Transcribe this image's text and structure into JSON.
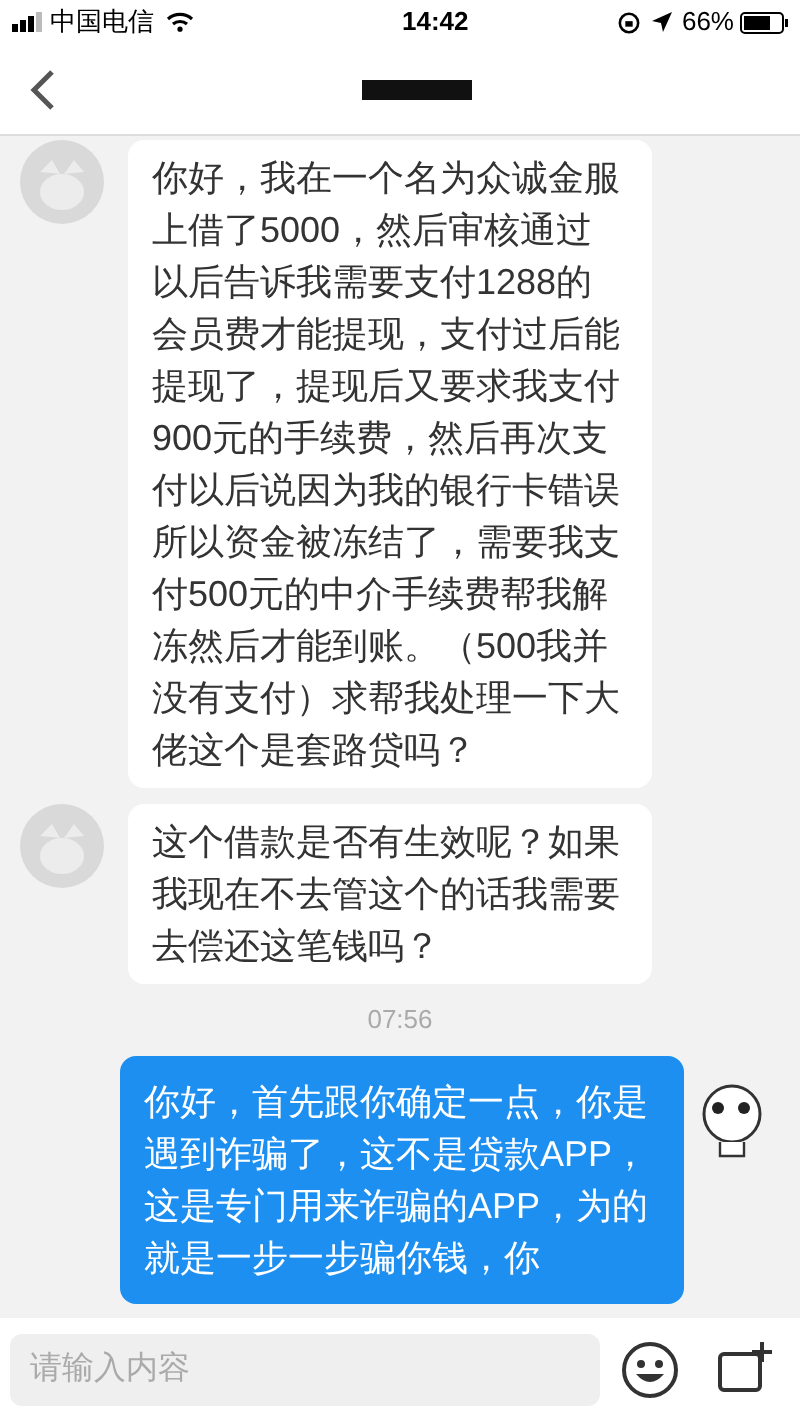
{
  "status_bar": {
    "carrier": "中国电信",
    "time": "14:42",
    "battery": "66%"
  },
  "messages": [
    {
      "kind": "incoming",
      "text": "你好，我在一个名为众诚金服上借了5000，然后审核通过以后告诉我需要支付1288的会员费才能提现，支付过后能提现了，提现后又要求我支付900元的手续费，然后再次支付以后说因为我的银行卡错误所以资金被冻结了，需要我支付500元的中介手续费帮我解冻然后才能到账。（500我并没有支付）求帮我处理一下大佬这个是套路贷吗？"
    },
    {
      "kind": "incoming",
      "text": "这个借款是否有生效呢？如果我现在不去管这个的话我需要去偿还这笔钱吗？"
    },
    {
      "kind": "time",
      "text": "07:56"
    },
    {
      "kind": "outgoing",
      "text": "你好，首先跟你确定一点，你是遇到诈骗了，这不是贷款APP，这是专门用来诈骗的APP，为的就是一步一步骗你钱，你"
    }
  ],
  "composer": {
    "placeholder": "请输入内容"
  }
}
